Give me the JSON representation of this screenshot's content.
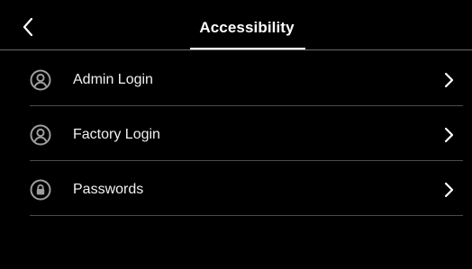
{
  "header": {
    "title": "Accessibility",
    "back_icon": "chevron-left-icon"
  },
  "menu": {
    "items": [
      {
        "label": "Admin Login",
        "icon": "user-circle-icon",
        "trailing_icon": "chevron-right-icon"
      },
      {
        "label": "Factory Login",
        "icon": "user-circle-icon",
        "trailing_icon": "chevron-right-icon"
      },
      {
        "label": "Passwords",
        "icon": "lock-circle-icon",
        "trailing_icon": "chevron-right-icon"
      }
    ]
  },
  "colors": {
    "background": "#000000",
    "text": "#ffffff",
    "icon": "#9e9e9e",
    "divider": "#4a4a4a"
  }
}
